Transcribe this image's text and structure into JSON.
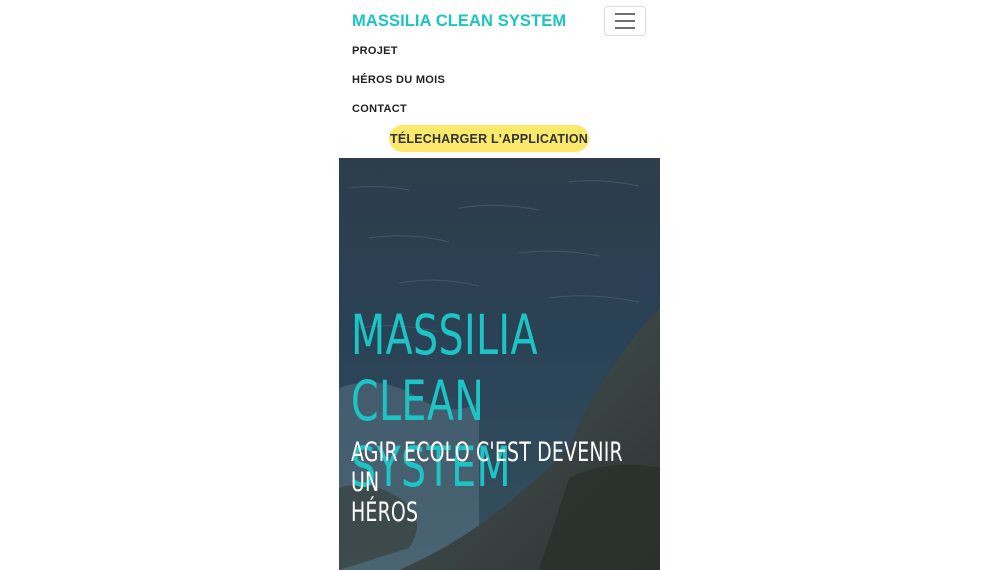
{
  "navbar": {
    "brand": "MASSILIA CLEAN SYSTEM",
    "links": [
      "PROJET",
      "HÉROS DU MOIS",
      "CONTACT"
    ],
    "download_button": "TÉLECHARGER L'APPLICATION",
    "toggler_icon": "hamburger-menu-icon"
  },
  "hero": {
    "title_line1": "MASSILIA",
    "title_line2": "CLEAN SYSTEM",
    "subtitle_line1": "AGIR ECOLO C'EST DEVENIR UN",
    "subtitle_line2": "HÉROS"
  },
  "colors": {
    "brand": "#1cc4c6",
    "button_bg": "#fbe96b",
    "hero_text": "#ffffff"
  }
}
